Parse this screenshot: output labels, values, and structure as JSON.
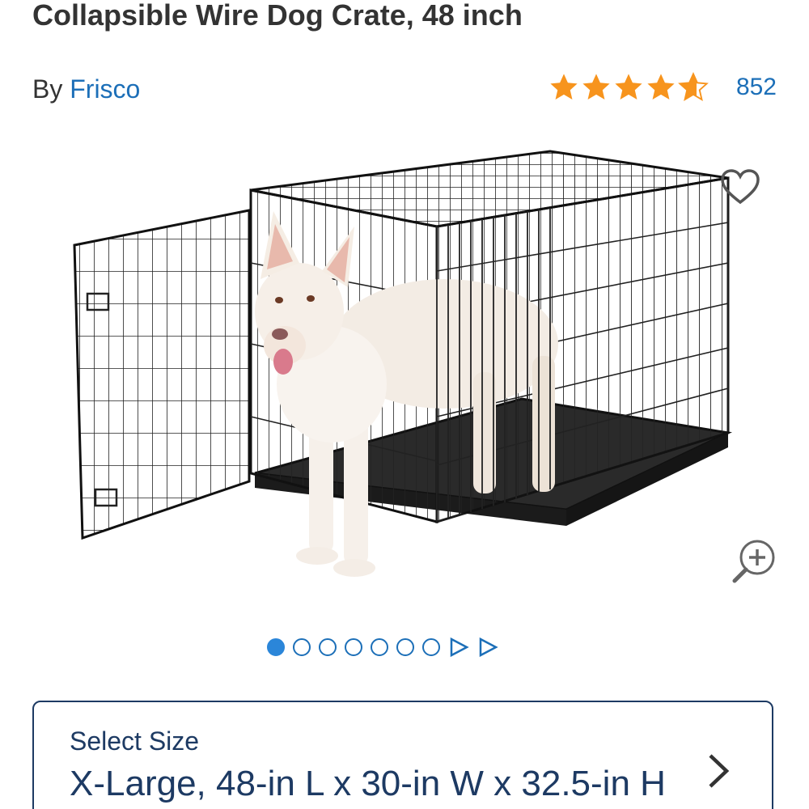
{
  "product": {
    "title": "Collapsible Wire Dog Crate, 48 inch",
    "by_prefix": "By",
    "brand": "Frisco",
    "rating": 4.5,
    "review_count": "852"
  },
  "gallery": {
    "image_alt": "Wire dog crate with dog",
    "favorite_icon": "heart-outline-icon",
    "zoom_icon": "zoom-in-icon",
    "dots_total": 7,
    "active_index": 0
  },
  "size_selector": {
    "label": "Select Size",
    "value": "X-Large, 48-in L x 30-in W x 32.5-in H"
  },
  "colors": {
    "link": "#1c6fb8",
    "star": "#f7941d",
    "selector_border": "#1d3a63",
    "active_dot": "#2b86d9"
  }
}
